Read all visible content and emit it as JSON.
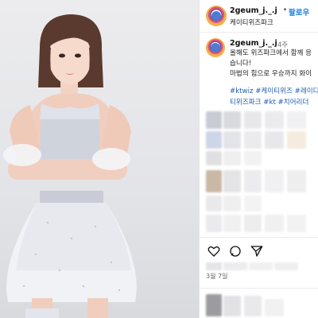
{
  "post": {
    "username": "2geum_j._.j",
    "follow_label": "팔로우",
    "dot": "•",
    "location": "케이티위즈파크",
    "comment_username": "2geum_j._.j",
    "comment_time": "4주",
    "caption_lines": [
      "올해도 위즈파크에서 함께 응",
      "습니다!",
      "마법의 힘으로 우승까지 화이"
    ],
    "hashtag_lines": [
      "#ktwiz #케이티위즈 #레이디",
      "티위즈파크 #kt #치어리더"
    ],
    "date": "3월 7일"
  },
  "icons": [
    "heart-icon",
    "comment-icon",
    "share-icon"
  ],
  "colors": {
    "link": "#1a7ee8",
    "hashtag": "#1e5bb8"
  }
}
